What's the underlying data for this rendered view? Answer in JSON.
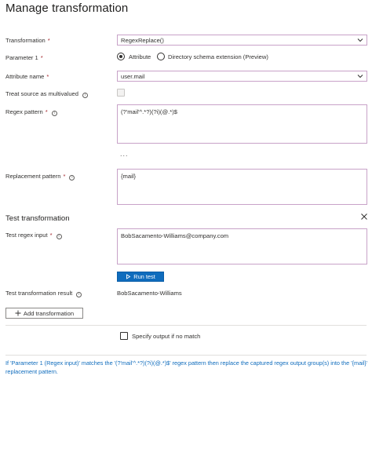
{
  "page_title": "Manage transformation",
  "transformation": {
    "label": "Transformation",
    "value": "RegexReplace()"
  },
  "parameter1": {
    "label": "Parameter 1",
    "options": [
      "Attribute",
      "Directory schema extension (Preview)"
    ],
    "selected": "Attribute"
  },
  "attribute_name": {
    "label": "Attribute name",
    "value": "user.mail"
  },
  "treat_multivalued": {
    "label": "Treat source as multivalued"
  },
  "regex_pattern": {
    "label": "Regex pattern",
    "value": "(?'mail'^.*?)(?i)(@.*)$"
  },
  "more": "...",
  "replacement_pattern": {
    "label": "Replacement pattern",
    "value": "{mail}"
  },
  "test": {
    "heading": "Test transformation",
    "input_label": "Test regex input",
    "input_value": "BobSacamento-Williams@company.com",
    "run_label": "Run test",
    "result_label": "Test transformation result",
    "result_value": "BobSacamento-Williams"
  },
  "add_transformation_label": "Add transformation",
  "specify_output_label": "Specify output if no match",
  "note": "If 'Parameter 1 (Regex input)' matches the '(?'mail'^.*?)(?i)(@.*)$' regex pattern then replace the captured regex output group(s) into the '{mail}' replacement pattern.",
  "colors": {
    "accent": "#0f6cbd",
    "field_border": "#c8a2c8",
    "required": "#a4262c"
  }
}
